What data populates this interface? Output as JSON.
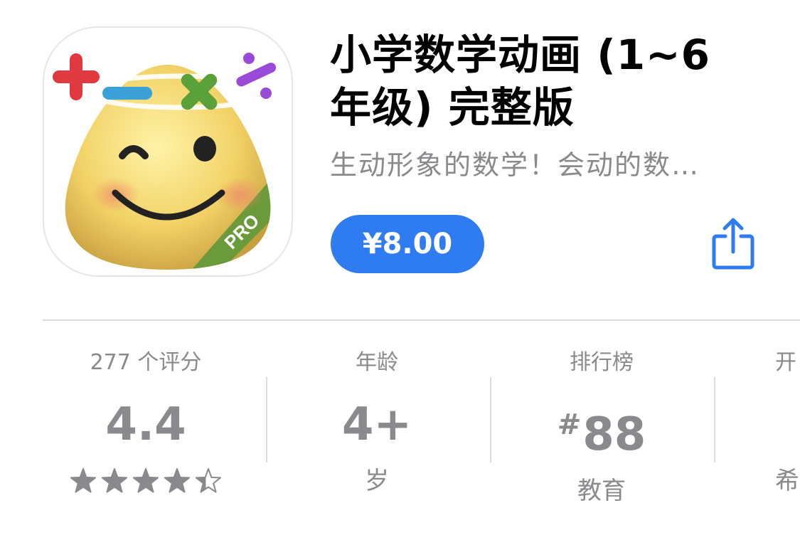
{
  "app": {
    "title_line1": "小学数学动画 (1~6",
    "title_line2": "年级) 完整版",
    "subtitle": "生动形象的数学！会动的数…",
    "price_label": "¥8.00",
    "icon_badge": "PRO",
    "accent_color": "#2f7bf2"
  },
  "stats": {
    "ratings": {
      "label": "277 个评分",
      "value": "4.4",
      "stars": 4.4
    },
    "age": {
      "label": "年龄",
      "value": "4+",
      "sub": "岁"
    },
    "chart": {
      "label": "排行榜",
      "hash": "#",
      "value": "88",
      "sub": "教育"
    },
    "partial": {
      "label": "开",
      "sub": "希"
    }
  },
  "icons": {
    "share": "share-icon",
    "app_icon": "app-icon-smiley"
  }
}
